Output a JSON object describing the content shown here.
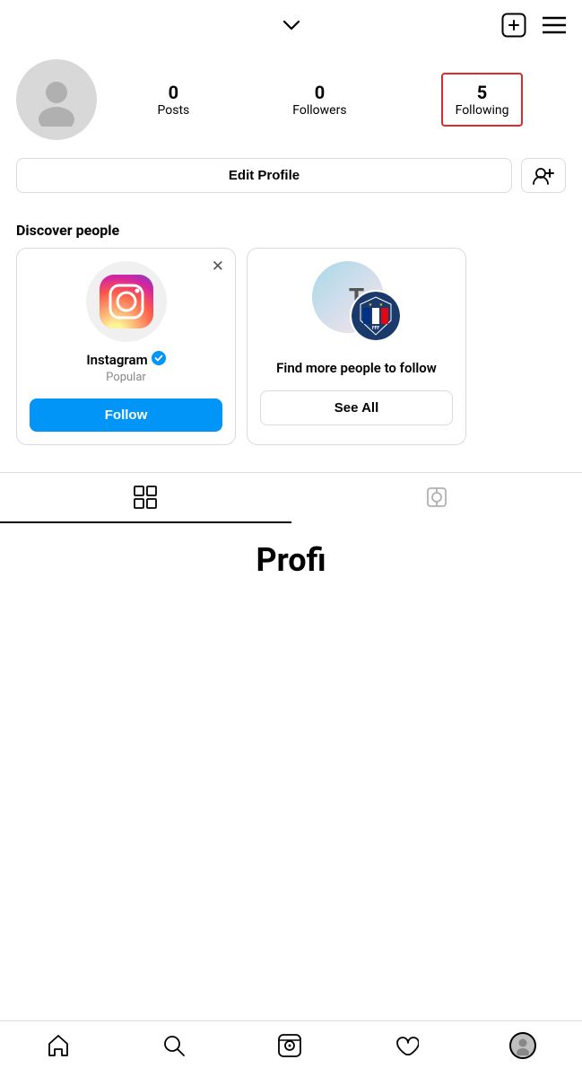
{
  "topbar": {
    "chevron": "∨",
    "add_icon": "new-post",
    "menu_icon": "hamburger-menu"
  },
  "profile": {
    "stats": {
      "posts": {
        "count": "0",
        "label": "Posts"
      },
      "followers": {
        "count": "0",
        "label": "Followers"
      },
      "following": {
        "count": "5",
        "label": "Following",
        "highlighted": true
      }
    }
  },
  "actions": {
    "edit_profile": "Edit Profile",
    "add_friend_icon": "add-friend"
  },
  "discover": {
    "section_title": "Discover people",
    "cards": [
      {
        "name": "Instagram",
        "sub": "Popular",
        "verified": true,
        "follow_label": "Follow"
      },
      {
        "find_more_text": "Find more people to follow",
        "see_all_label": "See All"
      }
    ]
  },
  "tabs": {
    "grid_tab": "grid",
    "tagged_tab": "tagged"
  },
  "partial_text": "Profi",
  "bottom_nav": {
    "home": "home",
    "search": "search",
    "reels": "reels",
    "likes": "heart",
    "profile": "profile-avatar"
  }
}
